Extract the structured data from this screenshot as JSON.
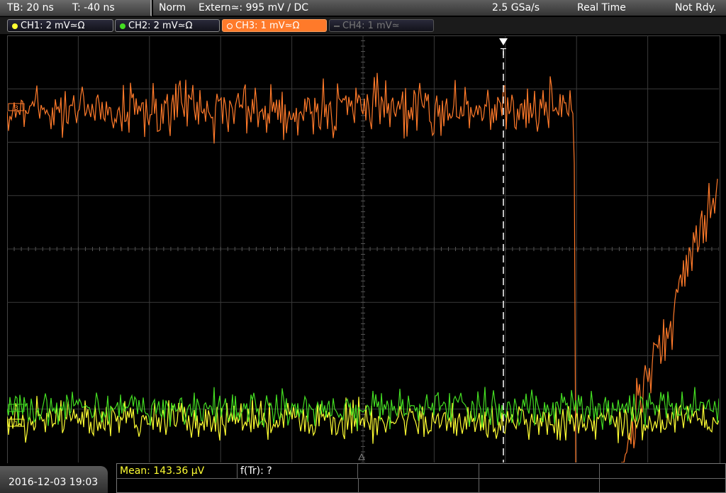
{
  "header": {
    "timebase": "TB: 20 ns",
    "trigger_time": "T: -40 ns",
    "acq_mode": "Norm",
    "trigger_source": "Extern≃: 995 mV ∕ DC",
    "sample_rate": "2.5 GSa/s",
    "time_mode": "Real Time",
    "status": "Not Rdy."
  },
  "channels": [
    {
      "label": "CH1: 2 mV≃Ω",
      "color": "#ffff33",
      "state": "on"
    },
    {
      "label": "CH2: 2 mV≃Ω",
      "color": "#44dd22",
      "state": "on"
    },
    {
      "label": "CH3: 1 mV≃Ω",
      "color": "#ff7a2a",
      "state": "active"
    },
    {
      "label": "CH4: 1 mV≃",
      "color": "#777777",
      "state": "off"
    }
  ],
  "markers": {
    "trigger": "T",
    "ch3_ref": "3",
    "ch2_ref": "2",
    "ch1_ref": "1"
  },
  "footer": {
    "datetime": "2016-12-03 19:03",
    "mean_label": "Mean: 143.36 μV",
    "ftr_label": "f(Tr): ?"
  },
  "colors": {
    "ch1": "#ffff33",
    "ch2": "#44dd22",
    "ch3": "#ff7a2a",
    "grid": "#3a3a3a"
  }
}
